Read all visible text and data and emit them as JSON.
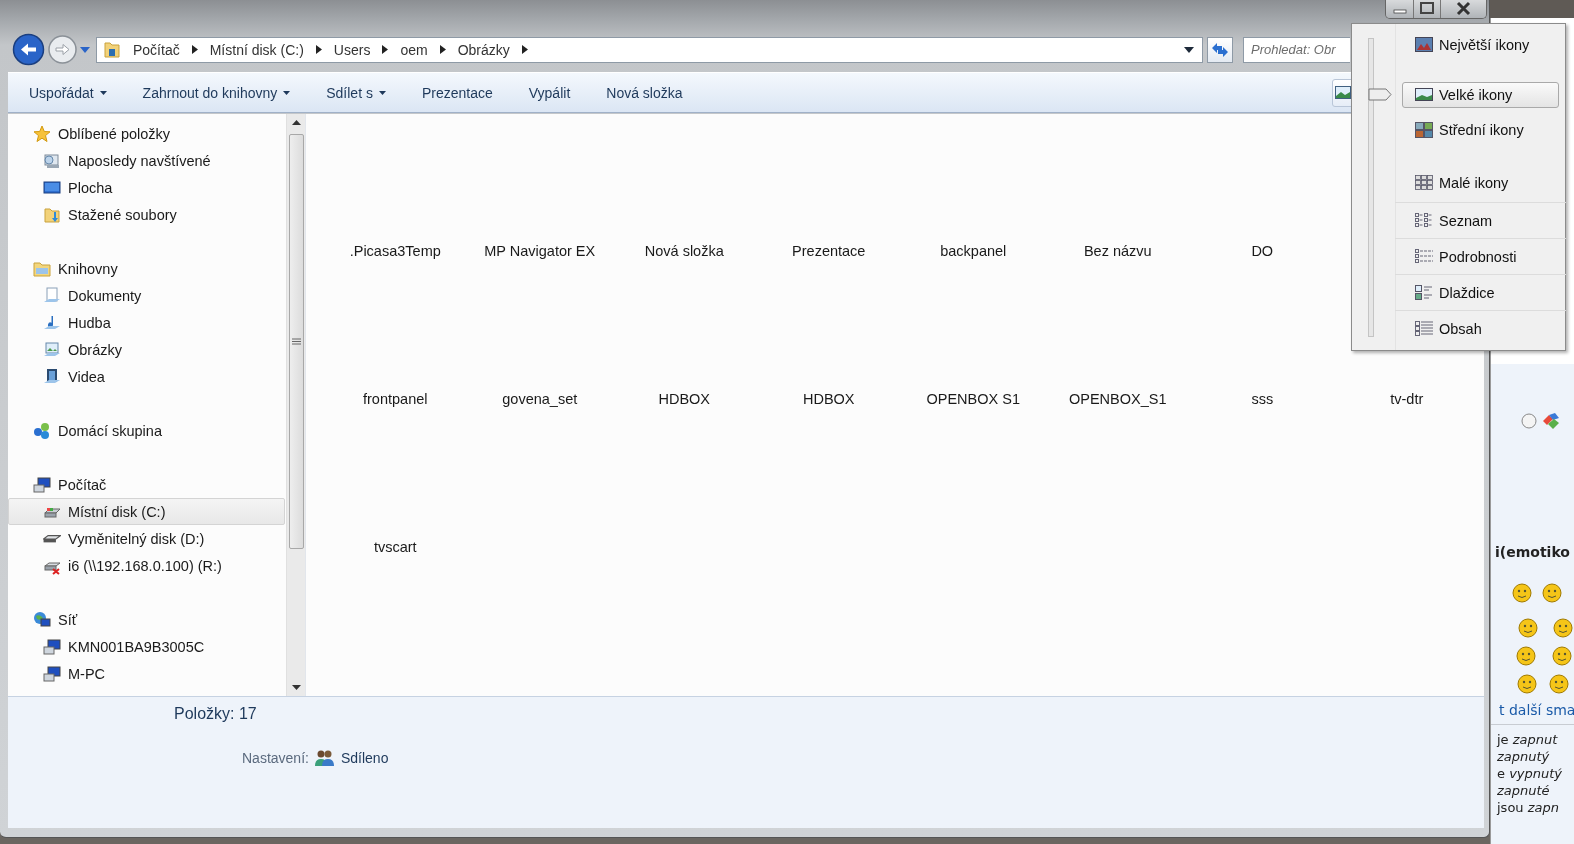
{
  "address_bar": {
    "path": [
      "Počítač",
      "Místní disk (C:)",
      "Users",
      "oem",
      "Obrázky"
    ]
  },
  "search": {
    "placeholder": "Prohledat: Obr"
  },
  "toolbar": {
    "buttons": [
      {
        "label": "Uspořádat",
        "dropdown": true
      },
      {
        "label": "Zahrnout do knihovny",
        "dropdown": true
      },
      {
        "label": "Sdílet s",
        "dropdown": true
      },
      {
        "label": "Prezentace",
        "dropdown": false
      },
      {
        "label": "Vypálit",
        "dropdown": false
      },
      {
        "label": "Nová složka",
        "dropdown": false
      }
    ]
  },
  "nav_pane": {
    "groups": [
      {
        "label": "Oblíbené položky",
        "kind": "star",
        "selected": false,
        "children": [
          {
            "label": "Naposledy navštívené",
            "kind": "recent",
            "selected": false
          },
          {
            "label": "Plocha",
            "kind": "desktop",
            "selected": false
          },
          {
            "label": "Stažené soubory",
            "kind": "downloads",
            "selected": false
          }
        ]
      },
      {
        "label": "Knihovny",
        "kind": "library",
        "selected": false,
        "children": [
          {
            "label": "Dokumenty",
            "kind": "document",
            "selected": false
          },
          {
            "label": "Hudba",
            "kind": "music",
            "selected": false
          },
          {
            "label": "Obrázky",
            "kind": "pictures",
            "selected": false
          },
          {
            "label": "Videa",
            "kind": "video",
            "selected": false
          }
        ]
      },
      {
        "label": "Domácí skupina",
        "kind": "homegroup",
        "selected": false
      },
      {
        "label": "Počítač",
        "kind": "computer",
        "selected": false,
        "children": [
          {
            "label": "Místní disk (C:)",
            "kind": "disk",
            "selected": true
          },
          {
            "label": "Vyměnitelný disk (D:)",
            "kind": "removable",
            "selected": false
          },
          {
            "label": "i6 (\\\\192.168.0.100) (R:)",
            "kind": "netdrive",
            "selected": false
          }
        ]
      },
      {
        "label": "Síť",
        "kind": "network",
        "selected": false,
        "children": [
          {
            "label": "KMN001BA9B3005C",
            "kind": "pc",
            "selected": false
          },
          {
            "label": "M-PC",
            "kind": "pc",
            "selected": false
          }
        ]
      }
    ]
  },
  "file_rows": [
    [
      ".Picasa3Temp",
      "MP Navigator EX",
      "Nová složka",
      "Prezentace",
      "backpanel",
      "Bez názvu",
      "DO"
    ],
    [
      "frontpanel",
      "govena_set",
      "HDBOX",
      "HDBOX",
      "OPENBOX S1",
      "OPENBOX_S1",
      "sss",
      "tv-dtr"
    ],
    [
      "tvscart"
    ]
  ],
  "details": {
    "count": "Položky: 17",
    "setting_label": "Nastavení:",
    "setting_value": "Sdíleno"
  },
  "view_menu": {
    "level": 0.81,
    "items": [
      {
        "label": "Největší ikony",
        "kind": "extra-large",
        "selected": false
      },
      {
        "label": "Velké ikony",
        "kind": "large",
        "selected": true
      },
      {
        "label": "Střední ikony",
        "kind": "medium",
        "selected": false
      },
      {
        "label": "Malé ikony",
        "kind": "small",
        "selected": false
      },
      {
        "label": "Seznam",
        "kind": "list",
        "selected": false
      },
      {
        "label": "Podrobnosti",
        "kind": "details",
        "selected": false
      },
      {
        "label": "Dlaždice",
        "kind": "tiles",
        "selected": false
      },
      {
        "label": "Obsah",
        "kind": "content",
        "selected": false
      }
    ]
  },
  "background_window": {
    "radio": {
      "selected": false
    },
    "heading": "i(emotiko",
    "link": "t další sma",
    "lines": [
      {
        "text": "je *zapnut*",
        "italic": false
      },
      {
        "text": "zapnutý",
        "italic": true
      },
      {
        "text": "e *vypnutý*",
        "italic": false
      },
      {
        "text": "zapnuté",
        "italic": true
      },
      {
        "text": "jsou *zapn*",
        "italic": false
      }
    ]
  }
}
